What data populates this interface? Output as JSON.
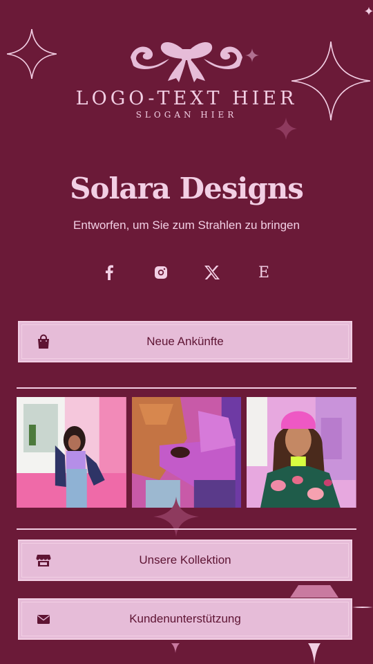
{
  "header": {
    "logo_text": "LOGO-TEXT HIER",
    "slogan": "SLOGAN HIER"
  },
  "profile": {
    "title": "Solara Designs",
    "subtitle": "Entworfen, um Sie zum Strahlen zu bringen"
  },
  "socials": [
    {
      "name": "facebook-icon",
      "glyph": "f"
    },
    {
      "name": "instagram-icon",
      "glyph": ""
    },
    {
      "name": "x-icon",
      "glyph": ""
    },
    {
      "name": "etsy-icon",
      "glyph": "E"
    }
  ],
  "buttons": {
    "new_arrivals": "Neue Ankünfte",
    "collection": "Unsere Kollektion",
    "support": "Kundenunterstützung"
  },
  "gallery": {
    "photos": [
      "woman-pink-wall-photo",
      "couple-hugging-photo",
      "woman-pink-beanie-photo"
    ]
  },
  "colors": {
    "background": "#6b1a38",
    "accent": "#f2cfe4",
    "button_bg": "#e6bcd8",
    "button_text": "#5e1433"
  }
}
